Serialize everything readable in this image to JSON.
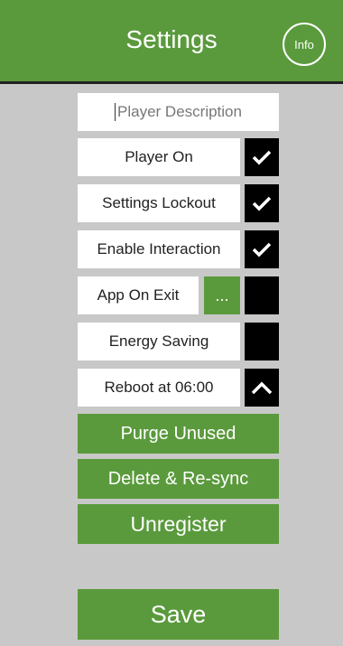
{
  "header": {
    "title": "Settings",
    "info_label": "Info"
  },
  "form": {
    "description_placeholder": "Player Description",
    "player_on": {
      "label": "Player On",
      "checked": true
    },
    "settings_lockout": {
      "label": "Settings Lockout",
      "checked": true
    },
    "enable_interaction": {
      "label": "Enable Interaction",
      "checked": true
    },
    "app_on_exit": {
      "label": "App On Exit",
      "browse_label": "...",
      "checked": false
    },
    "energy_saving": {
      "label": "Energy Saving",
      "checked": false
    },
    "reboot": {
      "label": "Reboot at 06:00",
      "icon": "chevron-up-icon"
    }
  },
  "actions": {
    "purge_label": "Purge Unused",
    "resync_label": "Delete & Re-sync",
    "unregister_label": "Unregister",
    "save_label": "Save"
  },
  "colors": {
    "accent": "#5a9a3c",
    "background": "#c8c8c8",
    "toggle_box": "#000000"
  }
}
